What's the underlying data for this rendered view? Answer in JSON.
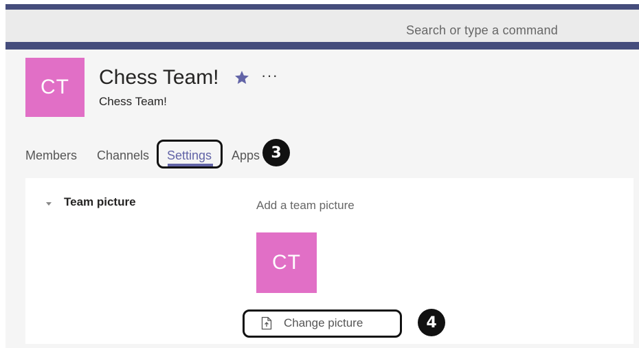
{
  "search": {
    "placeholder": "Search or type a command"
  },
  "team": {
    "avatar_initials": "CT",
    "name": "Chess Team!",
    "description": "Chess Team!",
    "more_label": "···"
  },
  "tabs": [
    {
      "label": "Members",
      "selected": false
    },
    {
      "label": "Channels",
      "selected": false
    },
    {
      "label": "Settings",
      "selected": true
    },
    {
      "label": "Apps",
      "selected": false
    }
  ],
  "callouts": {
    "step3": "3",
    "step4": "4"
  },
  "settings": {
    "section_title": "Team picture",
    "add_picture_label": "Add a team picture",
    "picture_initials": "CT",
    "change_button_label": "Change picture"
  },
  "colors": {
    "accent": "#6264a7",
    "header_band": "#454d7c",
    "avatar": "#e16fc6",
    "callout": "#111111"
  },
  "icons": {
    "favorite": "star-icon",
    "more": "more-options-icon",
    "collapse": "caret-down-icon",
    "upload": "upload-file-icon"
  }
}
